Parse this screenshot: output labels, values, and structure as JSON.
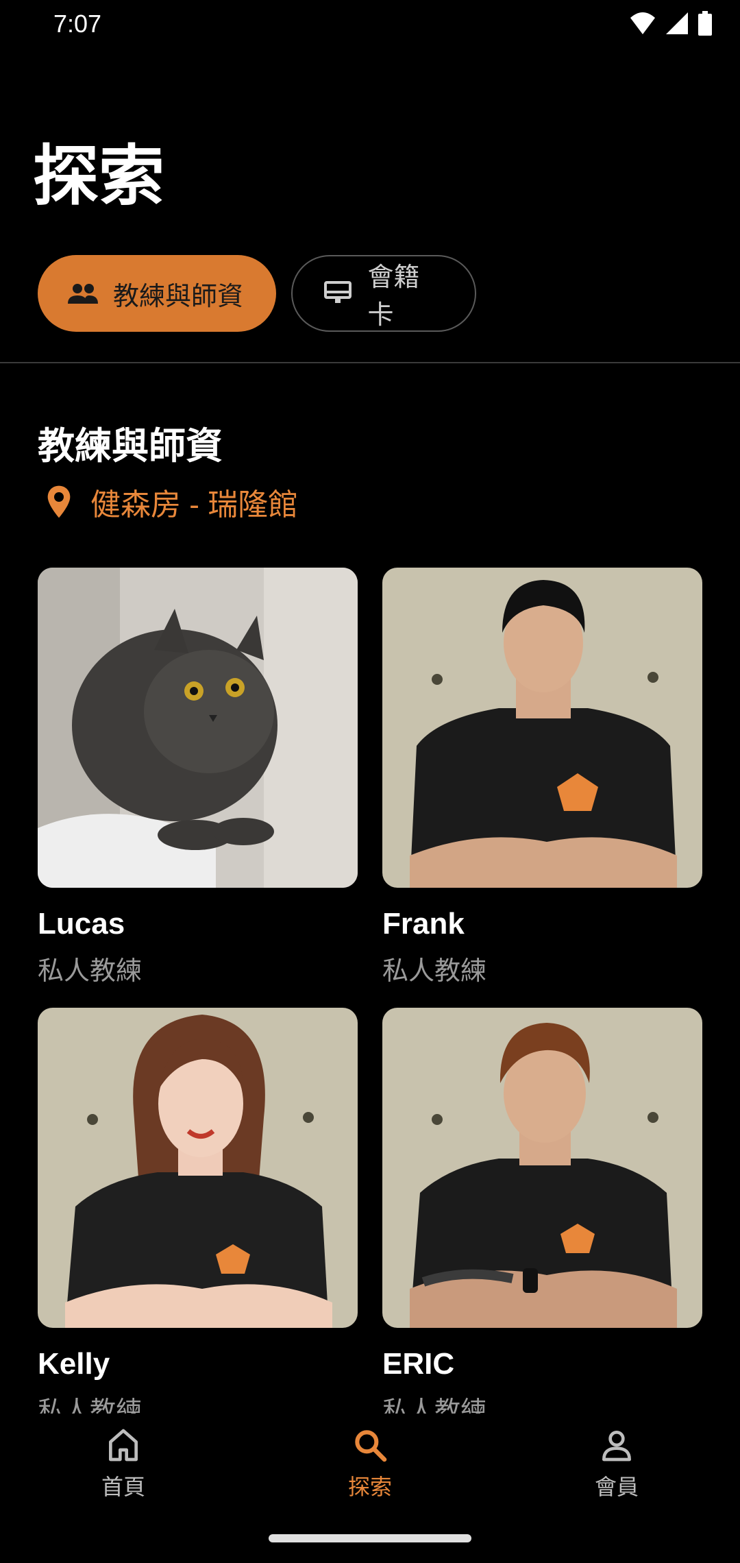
{
  "status_bar": {
    "time": "7:07",
    "icons": [
      "wifi-icon",
      "signal-icon",
      "battery-icon"
    ]
  },
  "header": {
    "title": "探索"
  },
  "tabs": [
    {
      "label": "教練與師資",
      "icon": "people-icon",
      "active": true
    },
    {
      "label": "會籍卡",
      "icon": "card-icon",
      "active": false
    }
  ],
  "section": {
    "title": "教練與師資",
    "location": "健森房 - 瑞隆館"
  },
  "coaches": [
    {
      "name": "Lucas",
      "role": "私人教練"
    },
    {
      "name": "Frank",
      "role": "私人教練"
    },
    {
      "name": "Kelly",
      "role": "私人教練"
    },
    {
      "name": "ERIC",
      "role": "私人教練"
    }
  ],
  "bottom_nav": [
    {
      "label": "首頁",
      "icon": "home-icon",
      "active": false
    },
    {
      "label": "探索",
      "icon": "search-icon",
      "active": true
    },
    {
      "label": "會員",
      "icon": "person-icon",
      "active": false
    }
  ],
  "colors": {
    "accent": "#d97a30",
    "accent_text": "#e8873a",
    "background": "#000000"
  }
}
